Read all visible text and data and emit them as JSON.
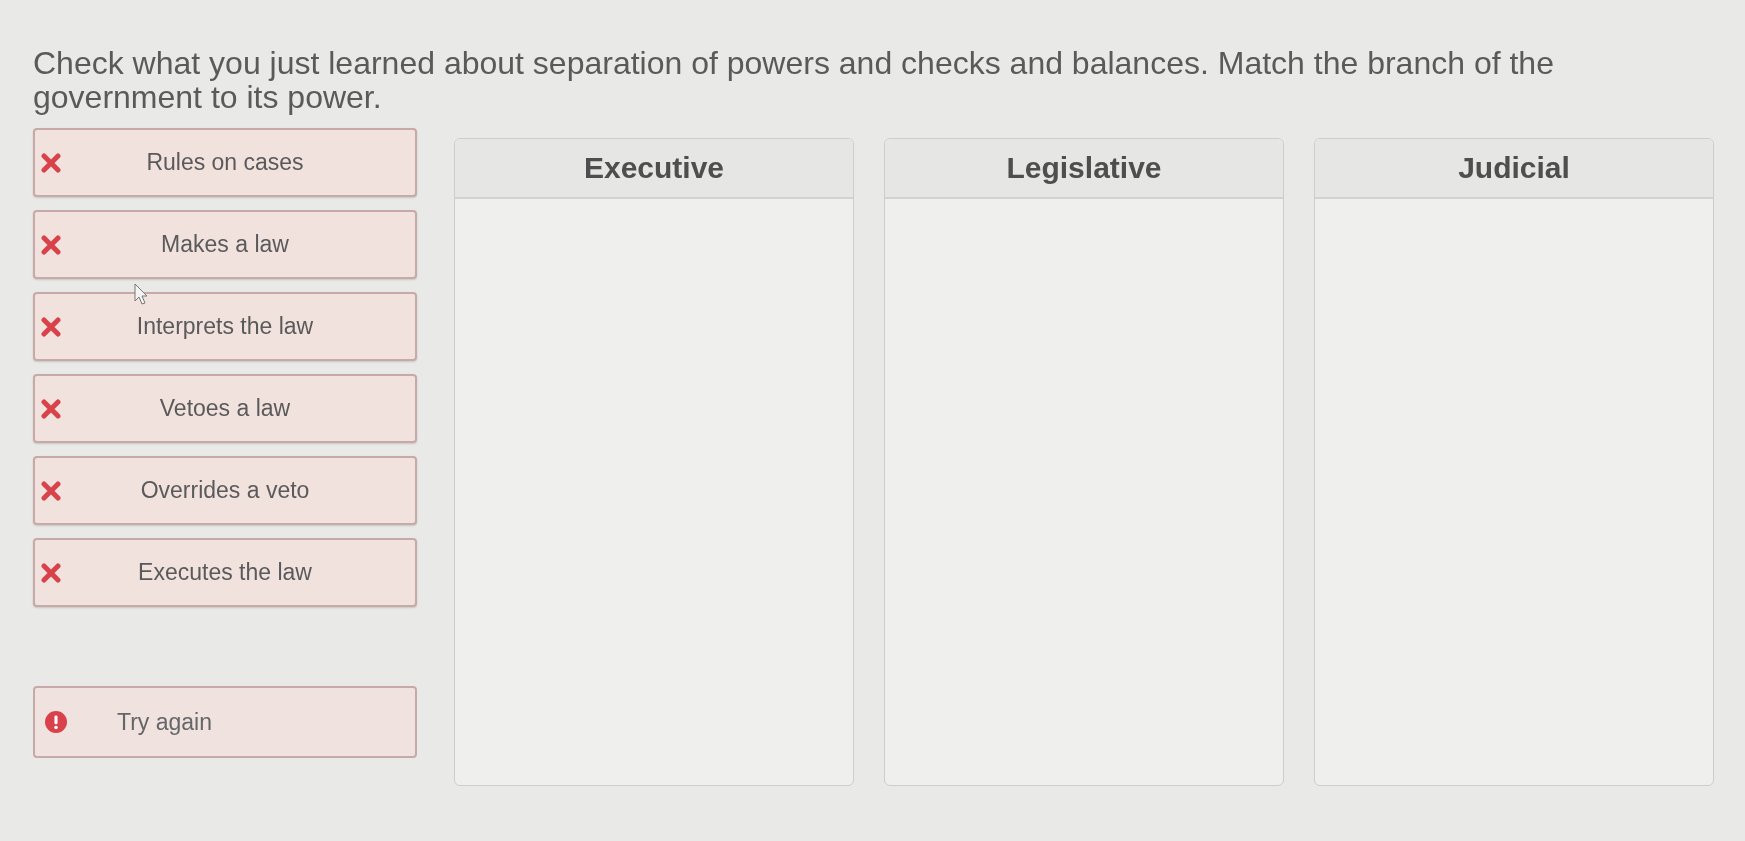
{
  "instructions": "Check what you just learned about separation of powers and checks and balances.  Match the branch of the government to its power.",
  "items": [
    {
      "label": "Rules on cases",
      "correct": false
    },
    {
      "label": "Makes a law",
      "correct": false
    },
    {
      "label": "Interprets the law",
      "correct": false
    },
    {
      "label": "Vetoes a law",
      "correct": false
    },
    {
      "label": "Overrides a veto",
      "correct": false
    },
    {
      "label": "Executes the law",
      "correct": false
    }
  ],
  "feedback": {
    "text": "Try again",
    "correct": false
  },
  "categories": [
    {
      "title": "Executive"
    },
    {
      "title": "Legislative"
    },
    {
      "title": "Judicial"
    }
  ]
}
